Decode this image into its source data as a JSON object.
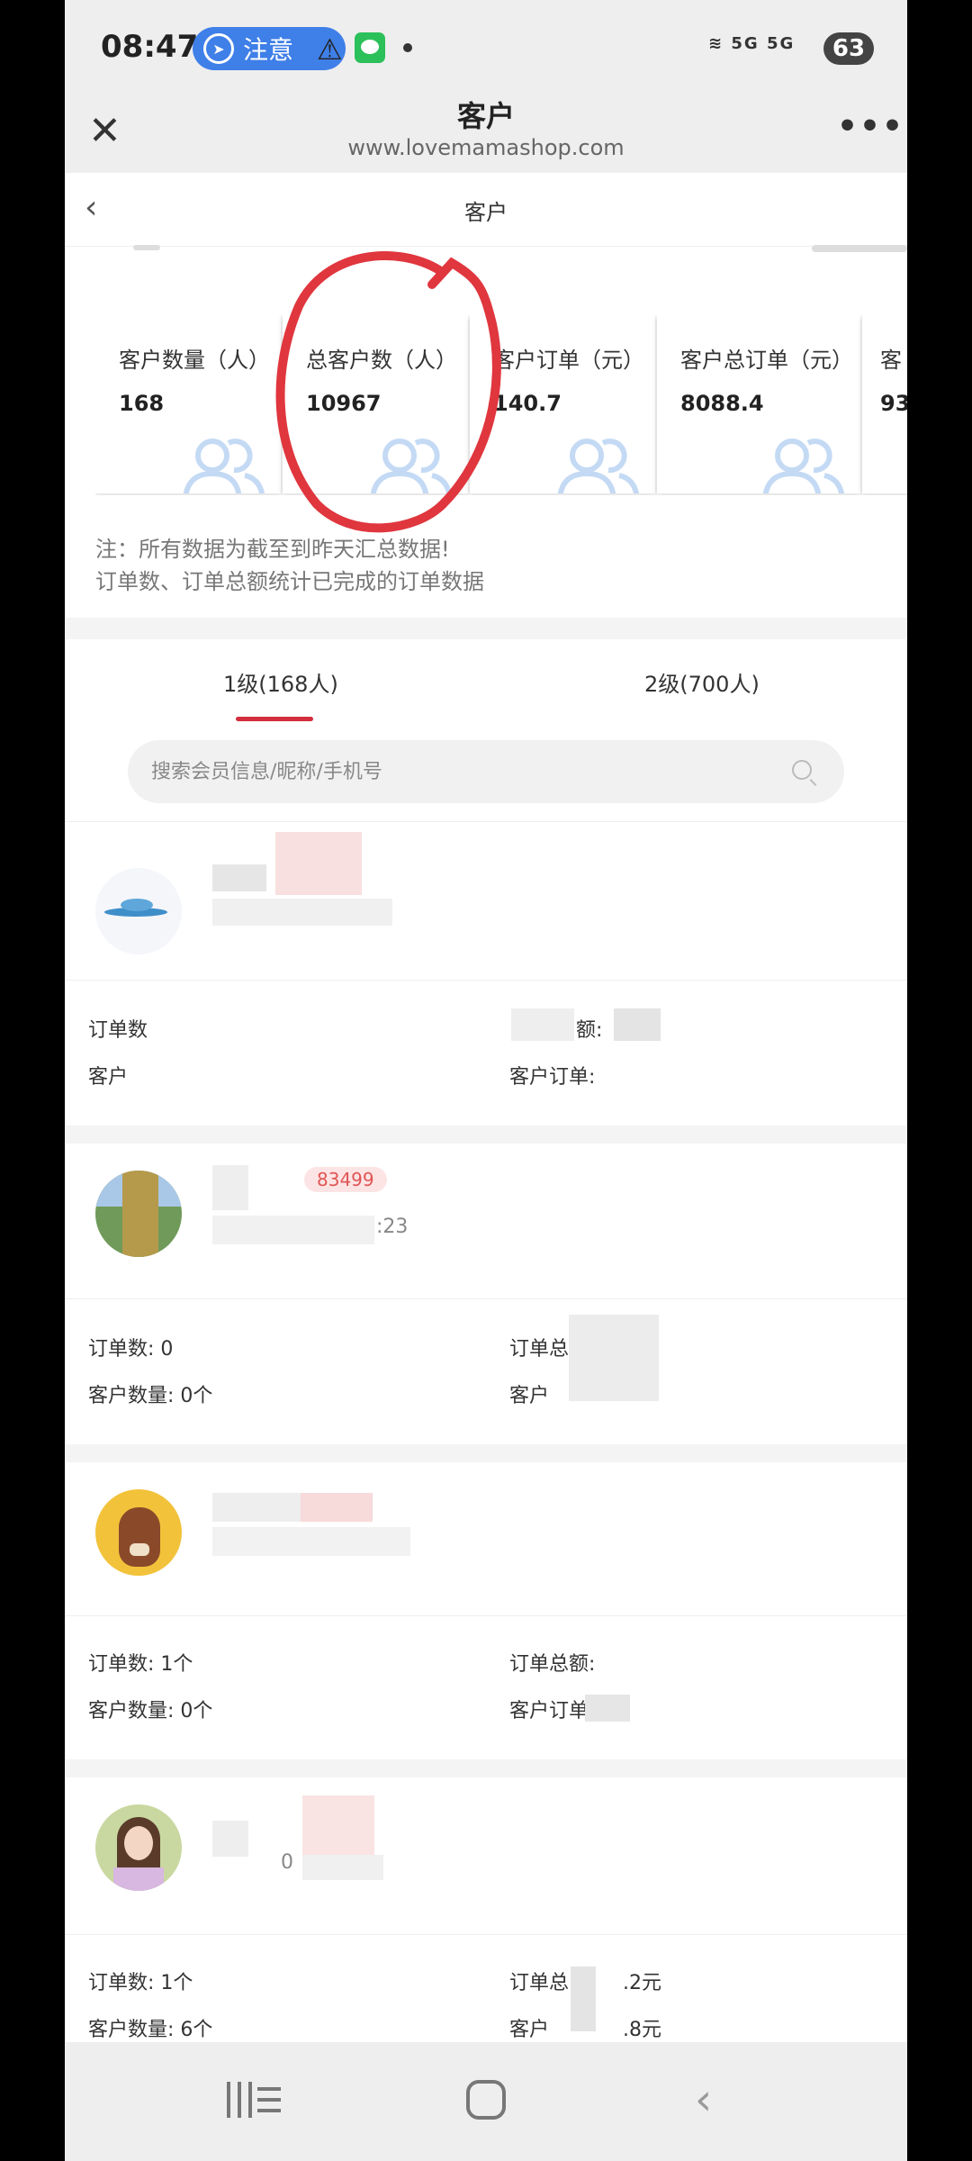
{
  "status_bar": {
    "time": "08:47",
    "notice_label": "注意",
    "network": "5G 5G",
    "battery": "63"
  },
  "browser": {
    "title": "客户",
    "url": "www.lovemamashop.com"
  },
  "page": {
    "title": "客户"
  },
  "stats": [
    {
      "label": "客户数量（人）",
      "value": "168"
    },
    {
      "label": "总客户数（人）",
      "value": "10967"
    },
    {
      "label": "客户订单（元）",
      "value": "140.7"
    },
    {
      "label": "客户总订单（元）",
      "value": "8088.4"
    },
    {
      "label": "客",
      "value": "93"
    }
  ],
  "notes": {
    "line1": "注：所有数据为截至到昨天汇总数据!",
    "line2": "订单数、订单总额统计已完成的订单数据"
  },
  "tabs": [
    {
      "label": "1级(168人)",
      "active": true
    },
    {
      "label": "2级(700人)",
      "active": false
    }
  ],
  "search": {
    "placeholder": "搜索会员信息/昵称/手机号"
  },
  "members": [
    {
      "left_line1": "订单数",
      "left_line2": "客户",
      "right_line1": "额:",
      "right_line2": "客户订单:"
    },
    {
      "badge": "83499",
      "meta": ":23",
      "left_line1": "订单数: 0",
      "left_line2": "客户数量: 0个",
      "right_line1": "订单总",
      "right_line2": "客户"
    },
    {
      "left_line1": "订单数: 1个",
      "left_line2": "客户数量: 0个",
      "right_line1": "订单总额:",
      "right_line2": "客户订单"
    },
    {
      "meta": "0",
      "left_line1": "订单数: 1个",
      "left_line2": "客户数量: 6个",
      "right_line1": "订单总",
      "right_line1_suffix": ".2元",
      "right_line2": "客户",
      "right_line2_suffix": ".8元"
    }
  ],
  "colors": {
    "accent": "#d22e3c",
    "notice": "#3f7fe8",
    "annotation_circle": "#e0363e"
  }
}
